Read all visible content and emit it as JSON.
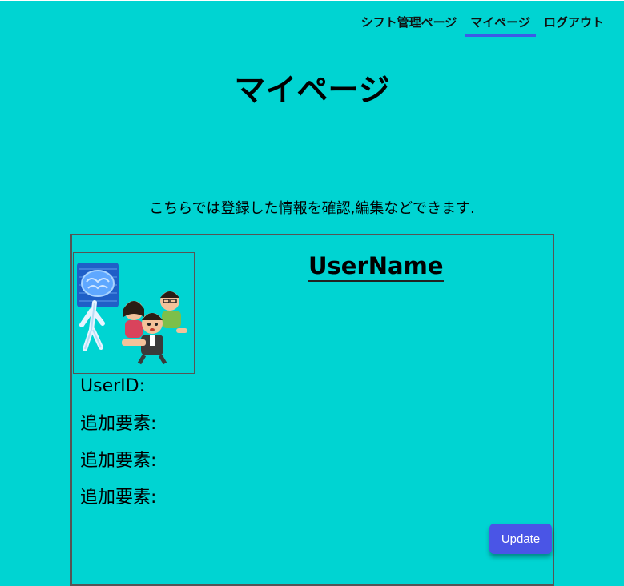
{
  "nav": {
    "items": [
      {
        "label": "シフト管理ページ",
        "active": false
      },
      {
        "label": "マイページ",
        "active": true
      },
      {
        "label": "ログアウト",
        "active": false
      }
    ]
  },
  "page": {
    "title": "マイページ",
    "intro": "こちらでは登録した情報を確認,編集などできます."
  },
  "profile": {
    "username": "UserName",
    "userid_label": "UserID:",
    "fields": [
      "追加要素:",
      "追加要素:",
      "追加要素:"
    ],
    "update_label": "Update"
  },
  "colors": {
    "background": "#00d4d2",
    "accent": "#3c5ce6",
    "button": "#4a55e6"
  }
}
